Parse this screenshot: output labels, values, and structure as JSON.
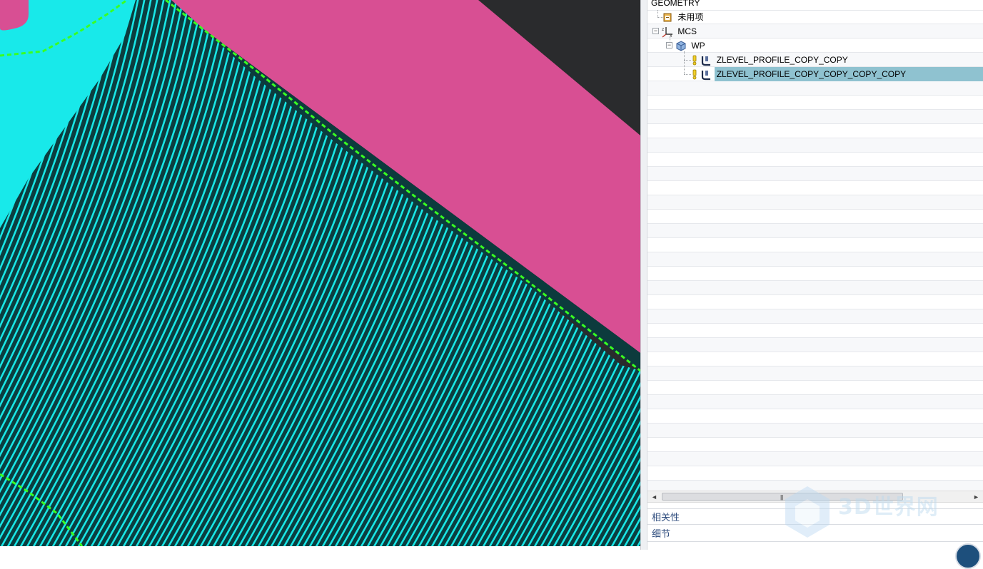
{
  "navigator": {
    "header": "GEOMETRY",
    "rows": [
      {
        "label": "未用项",
        "icon": "unused-items-icon"
      },
      {
        "label": "MCS",
        "icon": "mcs-coordinate-icon",
        "expander": "−"
      },
      {
        "label": "WP",
        "icon": "workpiece-icon",
        "expander": "−"
      },
      {
        "label": "ZLEVEL_PROFILE_COPY_COPY",
        "icon": "zlevel-operation-icon",
        "status_icon": "warning-icon"
      },
      {
        "label": "ZLEVEL_PROFILE_COPY_COPY_COPY_COPY",
        "icon": "zlevel-operation-icon",
        "status_icon": "warning-icon",
        "selected": true
      }
    ]
  },
  "panels": {
    "dependencies": "相关性",
    "details": "细节"
  },
  "scrollbar": {
    "left_arrow": "◄",
    "right_arrow": "►",
    "grip": "|||"
  },
  "watermark": {
    "text": "3D世界网"
  },
  "colors": {
    "viewport_background": "#2a2b2d",
    "part_surface": "#d84f93",
    "toolpath": "#19e6e6",
    "toolpath_dark": "#0a3a3c",
    "boundary": "#39ff22",
    "selection": "#8fc2d0"
  }
}
